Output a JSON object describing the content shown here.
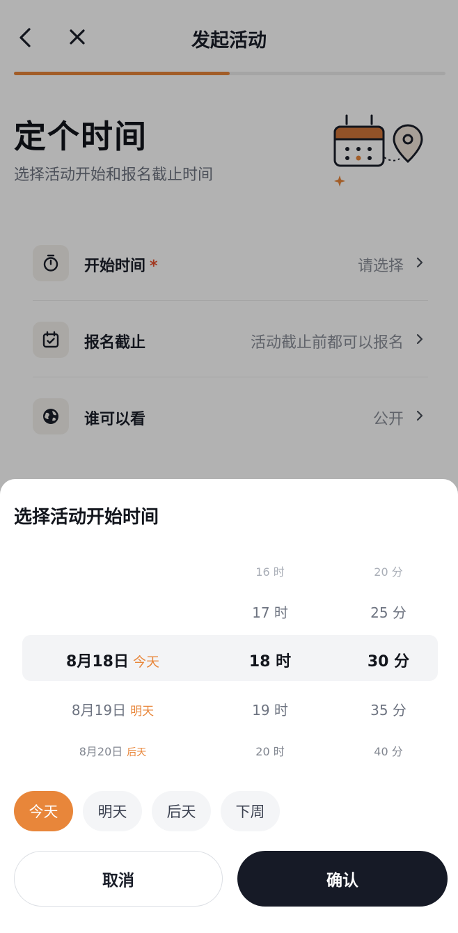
{
  "header": {
    "title": "发起活动",
    "back_icon": "chevron-left-icon",
    "close_icon": "close-icon",
    "progress_fraction": 0.5
  },
  "hero": {
    "title": "定个时间",
    "subtitle": "选择活动开始和报名截止时间",
    "illustration": "calendar-location-illustration"
  },
  "settings": {
    "rows": [
      {
        "icon": "stopwatch-icon",
        "label": "开始时间",
        "required_mark": "*",
        "value": "请选择"
      },
      {
        "icon": "calendar-check-icon",
        "label": "报名截止",
        "value": "活动截止前都可以报名"
      },
      {
        "icon": "globe-icon",
        "label": "谁可以看",
        "value": "公开"
      }
    ]
  },
  "sheet": {
    "title": "选择活动开始时间",
    "date_column": [
      {
        "date": "8月18日",
        "tag": "今天"
      },
      {
        "date": "8月19日",
        "tag": "明天"
      },
      {
        "date": "8月20日",
        "tag": "后天"
      }
    ],
    "hour_column": [
      "16 时",
      "17 时",
      "18 时",
      "19 时",
      "20 时"
    ],
    "minute_column": [
      "20 分",
      "25 分",
      "30 分",
      "35 分",
      "40 分"
    ],
    "quick_options": [
      "今天",
      "明天",
      "后天",
      "下周"
    ],
    "selected_quick_option": "今天",
    "cancel_label": "取消",
    "confirm_label": "确认"
  },
  "colors": {
    "accent": "#e8863a",
    "required": "#e8512e",
    "confirm_bg": "#161a26",
    "text_primary": "#12151c",
    "text_secondary": "#8a8f99"
  }
}
